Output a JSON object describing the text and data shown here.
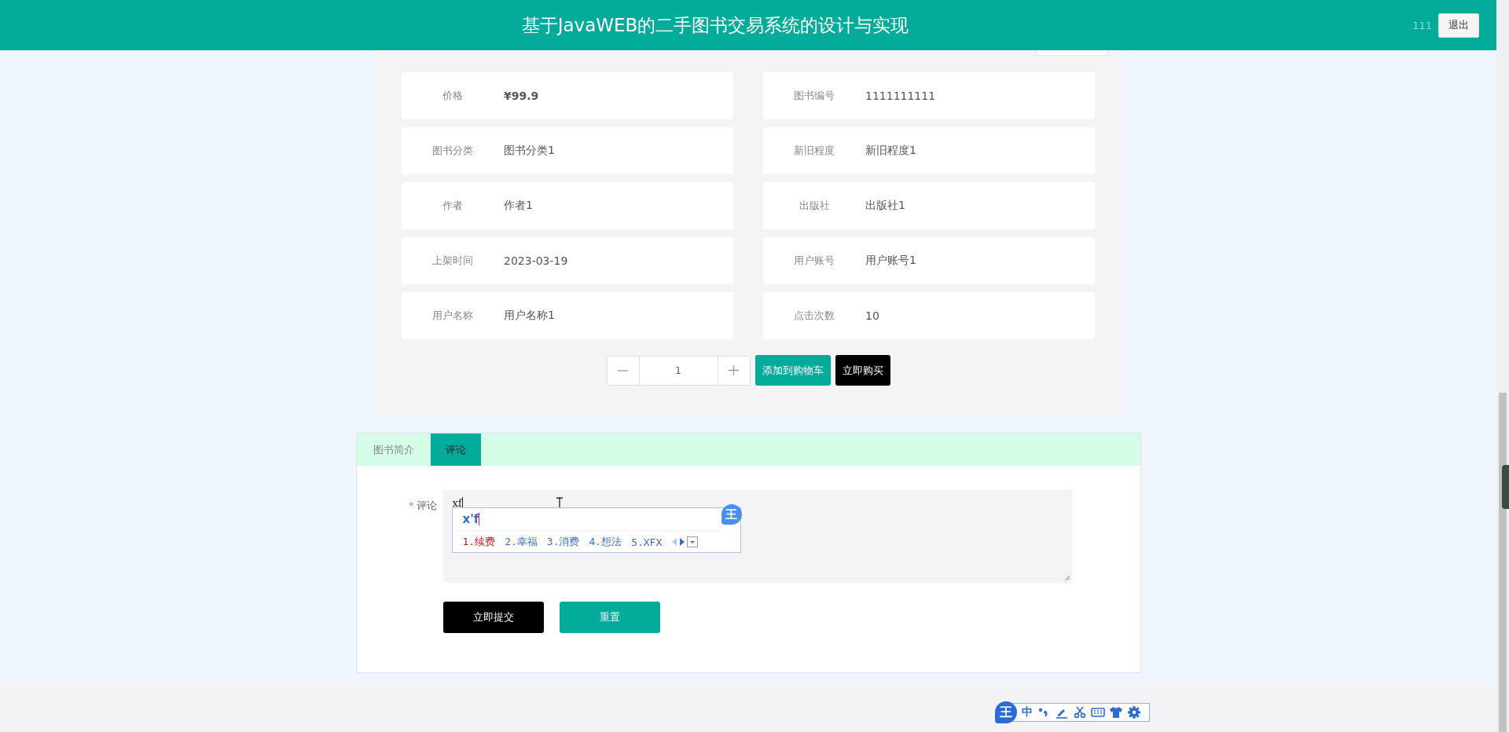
{
  "header": {
    "title": "基于JavaWEB的二手图书交易系统的设计与实现",
    "username": "111",
    "logout_button": "退出"
  },
  "details": {
    "fields": [
      {
        "label": "价格",
        "value": "¥99.9",
        "kind": "price"
      },
      {
        "label": "图书编号",
        "value": "1111111111",
        "kind": "text"
      },
      {
        "label": "图书分类",
        "value": "图书分类1",
        "kind": "text"
      },
      {
        "label": "新旧程度",
        "value": "新旧程度1",
        "kind": "text"
      },
      {
        "label": "作者",
        "value": "作者1",
        "kind": "text"
      },
      {
        "label": "出版社",
        "value": "出版社1",
        "kind": "text"
      },
      {
        "label": "上架时间",
        "value": "2023-03-19",
        "kind": "text"
      },
      {
        "label": "用户账号",
        "value": "用户账号1",
        "kind": "text"
      },
      {
        "label": "用户名称",
        "value": "用户名称1",
        "kind": "text"
      },
      {
        "label": "点击次数",
        "value": "10",
        "kind": "text"
      }
    ]
  },
  "purchase": {
    "quantity": "1",
    "add_to_cart_button": "添加到购物车",
    "buy_now_button": "立即购买"
  },
  "tabs": [
    {
      "label": "图书简介",
      "selected": false
    },
    {
      "label": "评论",
      "selected": true
    }
  ],
  "comment_form": {
    "label": "评论",
    "required": true,
    "required_mark": "*",
    "value": "xf",
    "submit_button": "立即提交",
    "reset_button": "重置"
  },
  "ime_popup": {
    "logo": "王",
    "composition": "x'f",
    "candidates": [
      {
        "label": "1.续费",
        "selected": true
      },
      {
        "label": "2.幸福",
        "selected": false
      },
      {
        "label": "3.消费",
        "selected": false
      },
      {
        "label": "4.想法",
        "selected": false
      },
      {
        "label": "5.XFX",
        "selected": false
      }
    ]
  },
  "ime_toolbar": {
    "logo": "王",
    "mode": "中"
  }
}
